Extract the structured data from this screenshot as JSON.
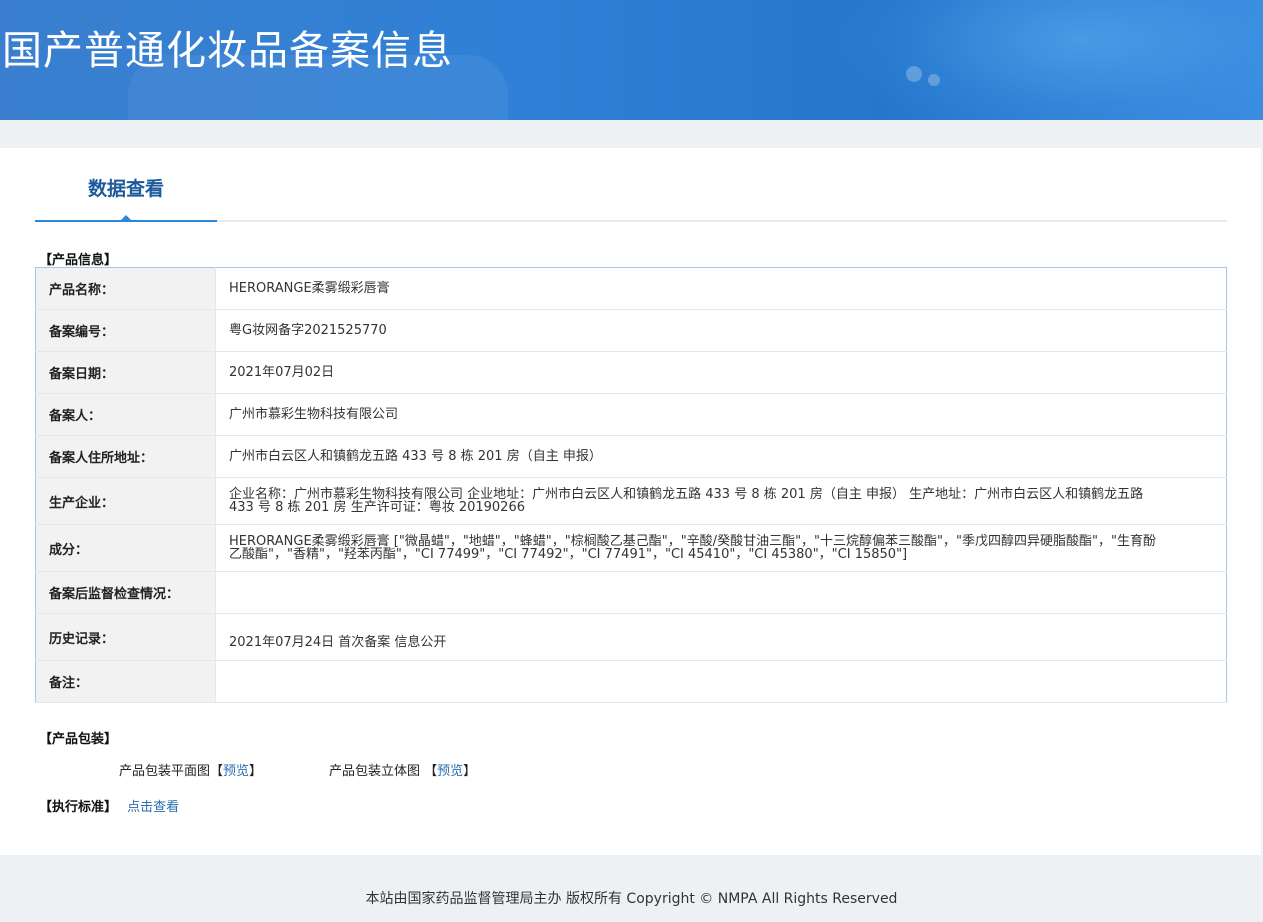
{
  "header": {
    "title": "国产普通化妆品备案信息"
  },
  "tab": {
    "label": "数据查看"
  },
  "product_info": {
    "section_label": "【产品信息】",
    "rows": [
      {
        "key": "产品名称：",
        "value": "HERORANGE柔雾缎彩唇膏"
      },
      {
        "key": "备案编号：",
        "value": "粤G妆网备字2021525770"
      },
      {
        "key": "备案日期：",
        "value": "2021年07月02日"
      },
      {
        "key": "备案人：",
        "value": "广州市慕彩生物科技有限公司"
      },
      {
        "key": "备案人住所地址：",
        "value": "广州市白云区人和镇鹤龙五路 433 号 8 栋 201 房（自主 申报）"
      },
      {
        "key": "生产企业：",
        "value": "企业名称：广州市慕彩生物科技有限公司 企业地址：广州市白云区人和镇鹤龙五路 433 号 8 栋 201 房（自主 申报） 生产地址：广州市白云区人和镇鹤龙五路 433 号 8 栋 201 房 生产许可证：粤妆 20190266"
      },
      {
        "key": "成分：",
        "value": "HERORANGE柔雾缎彩唇膏 [\"微晶蜡\"，\"地蜡\"，\"蜂蜡\"，\"棕榈酸乙基己酯\"，\"辛酸/癸酸甘油三酯\"，\"十三烷醇偏苯三酸酯\"，\"季戊四醇四异硬脂酸酯\"，\"生育酚乙酸酯\"，\"香精\"，\"羟苯丙酯\"，\"CI 77499\"，\"CI 77492\"，\"CI 77491\"，\"CI 45410\"，\"CI 45380\"，\"CI 15850\"]"
      },
      {
        "key": "备案后监督检查情况：",
        "value": ""
      },
      {
        "key": "历史记录：",
        "value": "2021年07月24日 首次备案 信息公开"
      },
      {
        "key": "备注：",
        "value": ""
      }
    ]
  },
  "packaging": {
    "section_label": "【产品包装】",
    "flat_label": "产品包装平面图",
    "stereo_label": "产品包装立体图",
    "bracket_open": "【",
    "bracket_open_spaced": " 【",
    "bracket_close": "】",
    "preview_label": "预览"
  },
  "standard": {
    "section_label": "【执行标准】",
    "link_label": "点击查看"
  },
  "footer": {
    "text": "本站由国家药品监督管理局主办 版权所有 Copyright © NMPA All Rights Reserved"
  },
  "colors": {
    "banner": "#2f80d6",
    "link": "#2a6db0",
    "tab_text": "#1d5a9a",
    "table_border": "#a9c6e3"
  }
}
